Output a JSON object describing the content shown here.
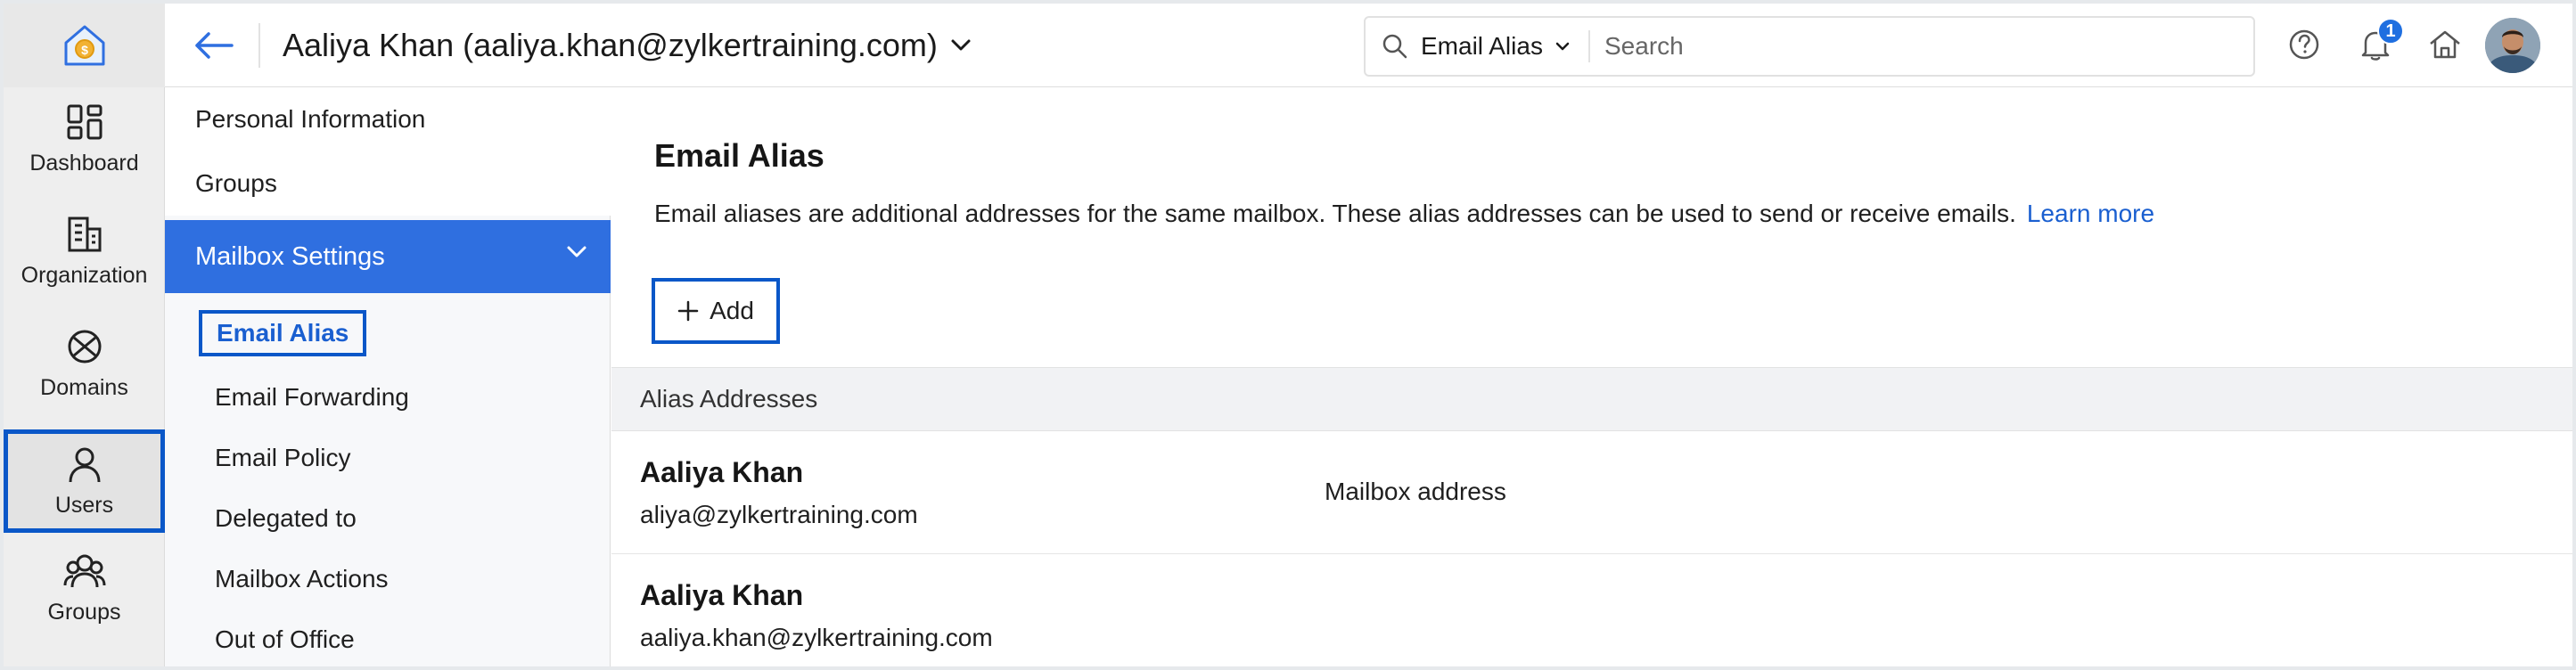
{
  "rail": {
    "items": [
      {
        "label": "Dashboard",
        "icon": "dashboard-icon"
      },
      {
        "label": "Organization",
        "icon": "organization-icon"
      },
      {
        "label": "Domains",
        "icon": "domains-icon"
      },
      {
        "label": "Users",
        "icon": "user-icon",
        "active": true
      },
      {
        "label": "Groups",
        "icon": "groups-icon"
      }
    ]
  },
  "header": {
    "user_title": "Aaliya Khan (aaliya.khan@zylkertraining.com)",
    "search_scope": "Email Alias",
    "search_placeholder": "Search",
    "notification_count": "1"
  },
  "subnav": {
    "top_items": [
      "Personal Information",
      "Groups"
    ],
    "section": "Mailbox Settings",
    "sub_items": [
      "Email Alias",
      "Email Forwarding",
      "Email Policy",
      "Delegated to",
      "Mailbox Actions",
      "Out of Office"
    ],
    "active_sub": "Email Alias"
  },
  "main": {
    "title": "Email Alias",
    "description": "Email aliases are additional addresses for the same mailbox. These alias addresses can be used to send or receive emails.",
    "learn_more": "Learn more",
    "add_label": "Add",
    "table_header": "Alias Addresses",
    "rows": [
      {
        "name": "Aaliya Khan",
        "email": "aliya@zylkertraining.com",
        "type": "Mailbox address"
      },
      {
        "name": "Aaliya Khan",
        "email": "aaliya.khan@zylkertraining.com",
        "type": ""
      }
    ]
  },
  "colors": {
    "accent": "#2f6fe0",
    "highlight_border": "#0a57c8",
    "link": "#1a5fd0"
  }
}
